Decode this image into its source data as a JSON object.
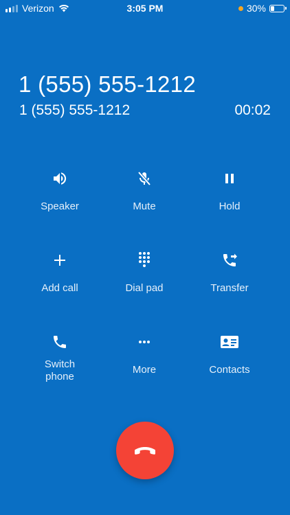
{
  "status_bar": {
    "carrier": "Verizon",
    "time": "3:05 PM",
    "battery_percent": "30%",
    "battery_level": 0.3,
    "dot_color": "#F5A623"
  },
  "call": {
    "number": "1 (555) 555-1212",
    "subtitle": "1 (555) 555-1212",
    "timer": "00:02"
  },
  "controls": [
    {
      "label": "Speaker",
      "icon": "speaker-icon"
    },
    {
      "label": "Mute",
      "icon": "mic-off-icon"
    },
    {
      "label": "Hold",
      "icon": "pause-icon"
    },
    {
      "label": "Add call",
      "icon": "plus-icon"
    },
    {
      "label": "Dial pad",
      "icon": "dialpad-icon"
    },
    {
      "label": "Transfer",
      "icon": "call-transfer-icon"
    },
    {
      "label": "Switch\nphone",
      "icon": "phone-icon"
    },
    {
      "label": "More",
      "icon": "more-horizontal-icon"
    },
    {
      "label": "Contacts",
      "icon": "contact-card-icon"
    }
  ],
  "end_call": {
    "icon": "hang-up-icon",
    "color": "#F44336"
  },
  "colors": {
    "background": "#0A6FC4",
    "text": "#ffffff"
  }
}
